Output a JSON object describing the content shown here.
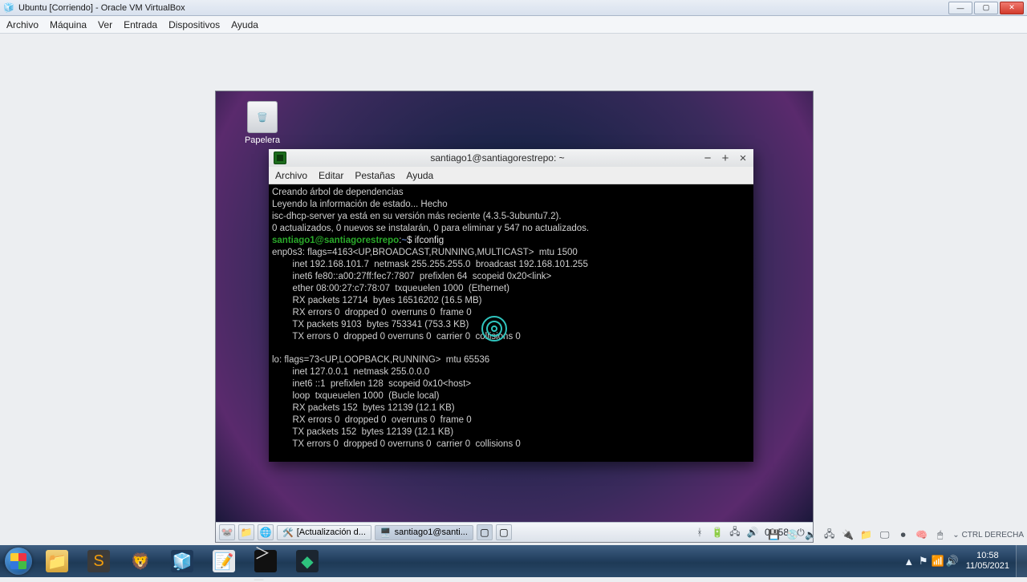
{
  "virtualbox": {
    "title": "Ubuntu [Corriendo] - Oracle VM VirtualBox",
    "menu": [
      "Archivo",
      "Máquina",
      "Ver",
      "Entrada",
      "Dispositivos",
      "Ayuda"
    ],
    "ctrl_label": "CTRL DERECHA"
  },
  "guest": {
    "desktop_icons": {
      "trash": "Papelera"
    },
    "panel": {
      "task_update": "[Actualización d...",
      "task_terminal": "santiago1@santi...",
      "clock": "09:58"
    }
  },
  "terminal": {
    "title": "santiago1@santiagorestrepo: ~",
    "menu": [
      "Archivo",
      "Editar",
      "Pestañas",
      "Ayuda"
    ],
    "prompt_user": "santiago1@santiagorestrepo",
    "prompt_path": ":~",
    "prompt_sym": "$",
    "cmd": "ifconfig",
    "output": {
      "deps1": "Creando árbol de dependencias",
      "deps2": "Leyendo la información de estado... Hecho",
      "deps3": "isc-dhcp-server ya está en su versión más reciente (4.3.5-3ubuntu7.2).",
      "deps4": "0 actualizados, 0 nuevos se instalarán, 0 para eliminar y 547 no actualizados.",
      "if_enp": "enp0s3: flags=4163<UP,BROADCAST,RUNNING,MULTICAST>  mtu 1500",
      "enp_inet": "        inet 192.168.101.7  netmask 255.255.255.0  broadcast 192.168.101.255",
      "enp_inet6": "        inet6 fe80::a00:27ff:fec7:7807  prefixlen 64  scopeid 0x20<link>",
      "enp_ether": "        ether 08:00:27:c7:78:07  txqueuelen 1000  (Ethernet)",
      "enp_rxp": "        RX packets 12714  bytes 16516202 (16.5 MB)",
      "enp_rxe": "        RX errors 0  dropped 0  overruns 0  frame 0",
      "enp_txp": "        TX packets 9103  bytes 753341 (753.3 KB)",
      "enp_txe": "        TX errors 0  dropped 0 overruns 0  carrier 0  collisions 0",
      "if_lo": "lo: flags=73<UP,LOOPBACK,RUNNING>  mtu 65536",
      "lo_inet": "        inet 127.0.0.1  netmask 255.0.0.0",
      "lo_inet6": "        inet6 ::1  prefixlen 128  scopeid 0x10<host>",
      "lo_loop": "        loop  txqueuelen 1000  (Bucle local)",
      "lo_rxp": "        RX packets 152  bytes 12139 (12.1 KB)",
      "lo_rxe": "        RX errors 0  dropped 0  overruns 0  frame 0",
      "lo_txp": "        TX packets 152  bytes 12139 (12.1 KB)",
      "lo_txe": "        TX errors 0  dropped 0 overruns 0  carrier 0  collisions 0"
    }
  },
  "windows": {
    "clock_time": "10:58",
    "clock_date": "11/05/2021"
  }
}
